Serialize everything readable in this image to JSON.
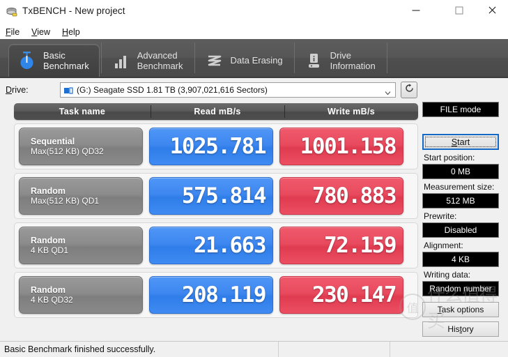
{
  "window": {
    "title": "TxBENCH - New project",
    "icon": "app-drive-icon",
    "minimize": "minimize-icon",
    "maximize": "maximize-icon",
    "close": "close-icon"
  },
  "menu": {
    "items": [
      {
        "label": "File",
        "accel": "F"
      },
      {
        "label": "View",
        "accel": "V"
      },
      {
        "label": "Help",
        "accel": "H"
      }
    ]
  },
  "tabs": [
    {
      "label": "Basic\nBenchmark",
      "icon": "stopwatch-icon",
      "active": true
    },
    {
      "label": "Advanced\nBenchmark",
      "icon": "bar-chart-icon",
      "active": false
    },
    {
      "label": "Data Erasing",
      "icon": "eraser-wave-icon",
      "active": false
    },
    {
      "label": "Drive\nInformation",
      "icon": "drive-info-icon",
      "active": false
    }
  ],
  "drive": {
    "label": "Drive:",
    "accel": "D",
    "value": "(G:) Seagate SSD  1.81 TB (3,907,021,616 Sectors)",
    "icon": "drive-icon",
    "caret": "chevron-down-icon",
    "refresh_icon": "refresh-icon"
  },
  "benchmark": {
    "columns": [
      "Task name",
      "Read mB/s",
      "Write mB/s"
    ],
    "rows": [
      {
        "name_line1": "Sequential",
        "name_line2": "Max(512 KB) QD32",
        "read": "1025.781",
        "write": "1001.158"
      },
      {
        "name_line1": "Random",
        "name_line2": "Max(512 KB) QD1",
        "read": "575.814",
        "write": "780.883"
      },
      {
        "name_line1": "Random",
        "name_line2": "4 KB QD1",
        "read": "21.663",
        "write": "72.159"
      },
      {
        "name_line1": "Random",
        "name_line2": "4 KB QD32",
        "read": "208.119",
        "write": "230.147"
      }
    ]
  },
  "side": {
    "mode": "FILE mode",
    "start": "Start",
    "start_accel": "S",
    "start_position_label": "Start position:",
    "start_position_value": "0 MB",
    "measurement_label": "Measurement size:",
    "measurement_value": "512 MB",
    "prewrite_label": "Prewrite:",
    "prewrite_value": "Disabled",
    "alignment_label": "Alignment:",
    "alignment_value": "4 KB",
    "writing_label": "Writing data:",
    "writing_value": "Random number",
    "task_options": "Task options",
    "task_options_accel": "T",
    "history": "History",
    "history_accel": "t"
  },
  "status": {
    "message": "Basic Benchmark finished successfully.",
    "cell2": "",
    "cell3": ""
  },
  "watermark": {
    "mark": "值",
    "text": "什么值得买"
  },
  "colors": {
    "read_blue": "#3f8bf2",
    "write_red": "#e84a5e",
    "tab_bar": "#565656",
    "accent_focus": "#1569c6",
    "value_text": "#ffffff"
  }
}
